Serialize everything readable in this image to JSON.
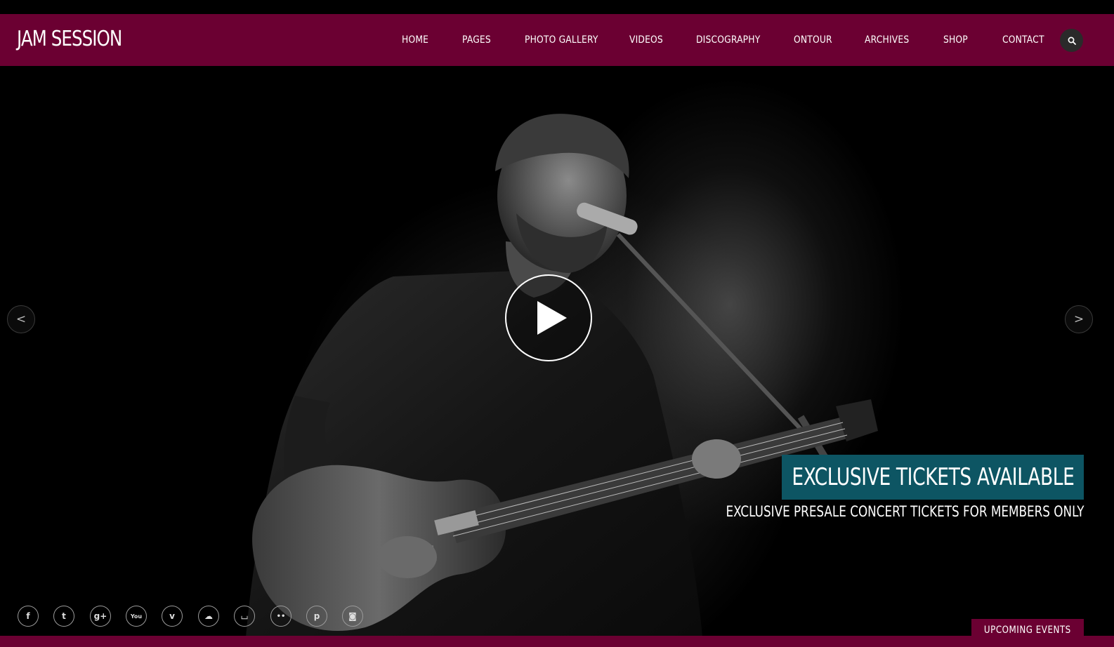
{
  "brand": {
    "logo": "JAM SESSION"
  },
  "nav": {
    "items": [
      "HOME",
      "PAGES",
      "PHOTO GALLERY",
      "VIDEOS",
      "DISCOGRAPHY",
      "ONTOUR",
      "ARCHIVES",
      "SHOP",
      "CONTACT"
    ],
    "search_icon": "search-icon"
  },
  "slider": {
    "prev_label": "<",
    "next_label": ">",
    "play_icon": "play-icon",
    "headline": "EXCLUSIVE TICKETS AVAILABLE",
    "subline": "EXCLUSIVE PRESALE CONCERT TICKETS FOR MEMBERS ONLY"
  },
  "social": {
    "icons": [
      {
        "name": "facebook-icon",
        "glyph": "f"
      },
      {
        "name": "twitter-icon",
        "glyph": "t"
      },
      {
        "name": "google-plus-icon",
        "glyph": "g+"
      },
      {
        "name": "youtube-icon",
        "glyph": "You"
      },
      {
        "name": "vimeo-icon",
        "glyph": "v"
      },
      {
        "name": "soundcloud-icon",
        "glyph": "☁"
      },
      {
        "name": "lastfm-icon",
        "glyph": "⌴"
      },
      {
        "name": "flickr-icon",
        "glyph": "••"
      },
      {
        "name": "pinterest-icon",
        "glyph": "p"
      },
      {
        "name": "instagram-icon",
        "glyph": "◙"
      }
    ]
  },
  "events": {
    "label": "UPCOMING EVENTS"
  },
  "colors": {
    "brand": "#6b0032",
    "headline_bg": "#0d5563",
    "background": "#000000"
  }
}
